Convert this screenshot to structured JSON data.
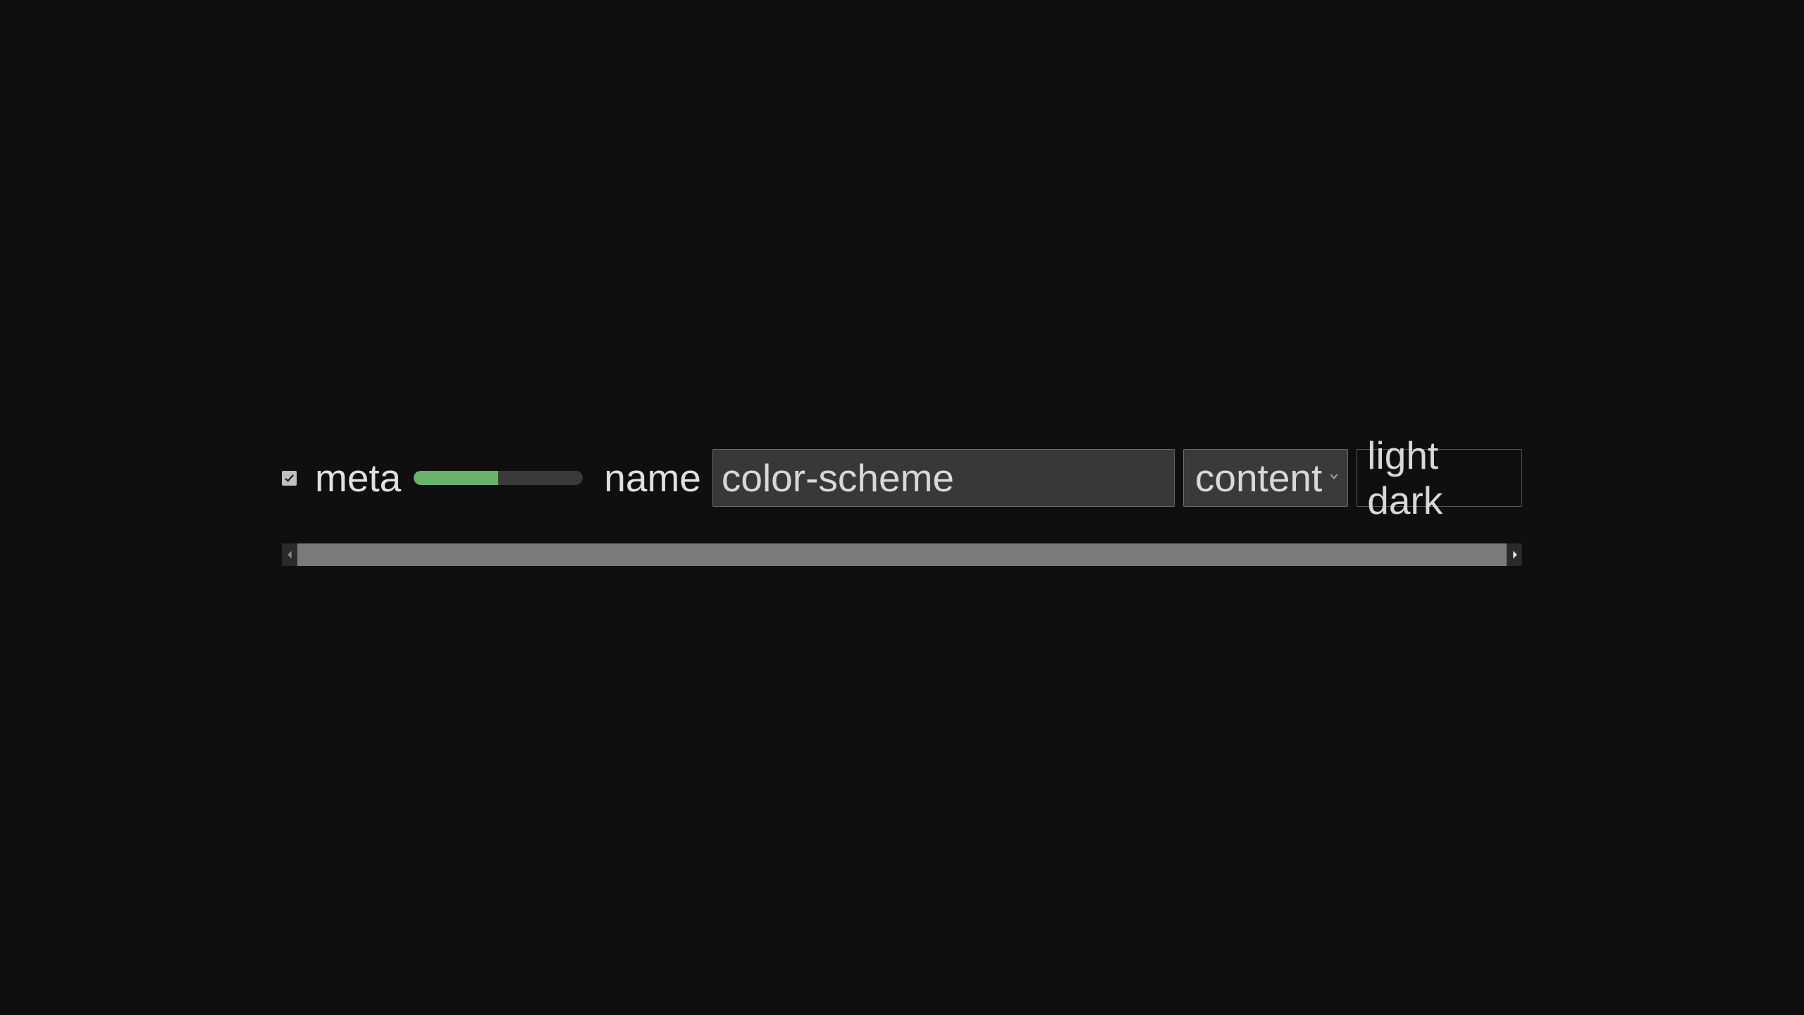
{
  "row": {
    "checkbox_checked": true,
    "meta_label": "meta",
    "progress_percent": 50,
    "name_label": "name",
    "name_input_value": "color-scheme",
    "content_select_value": "content",
    "value_box_text": "light dark"
  },
  "colors": {
    "progress_fill": "#6bb36b",
    "background": "#0f0f0f"
  }
}
